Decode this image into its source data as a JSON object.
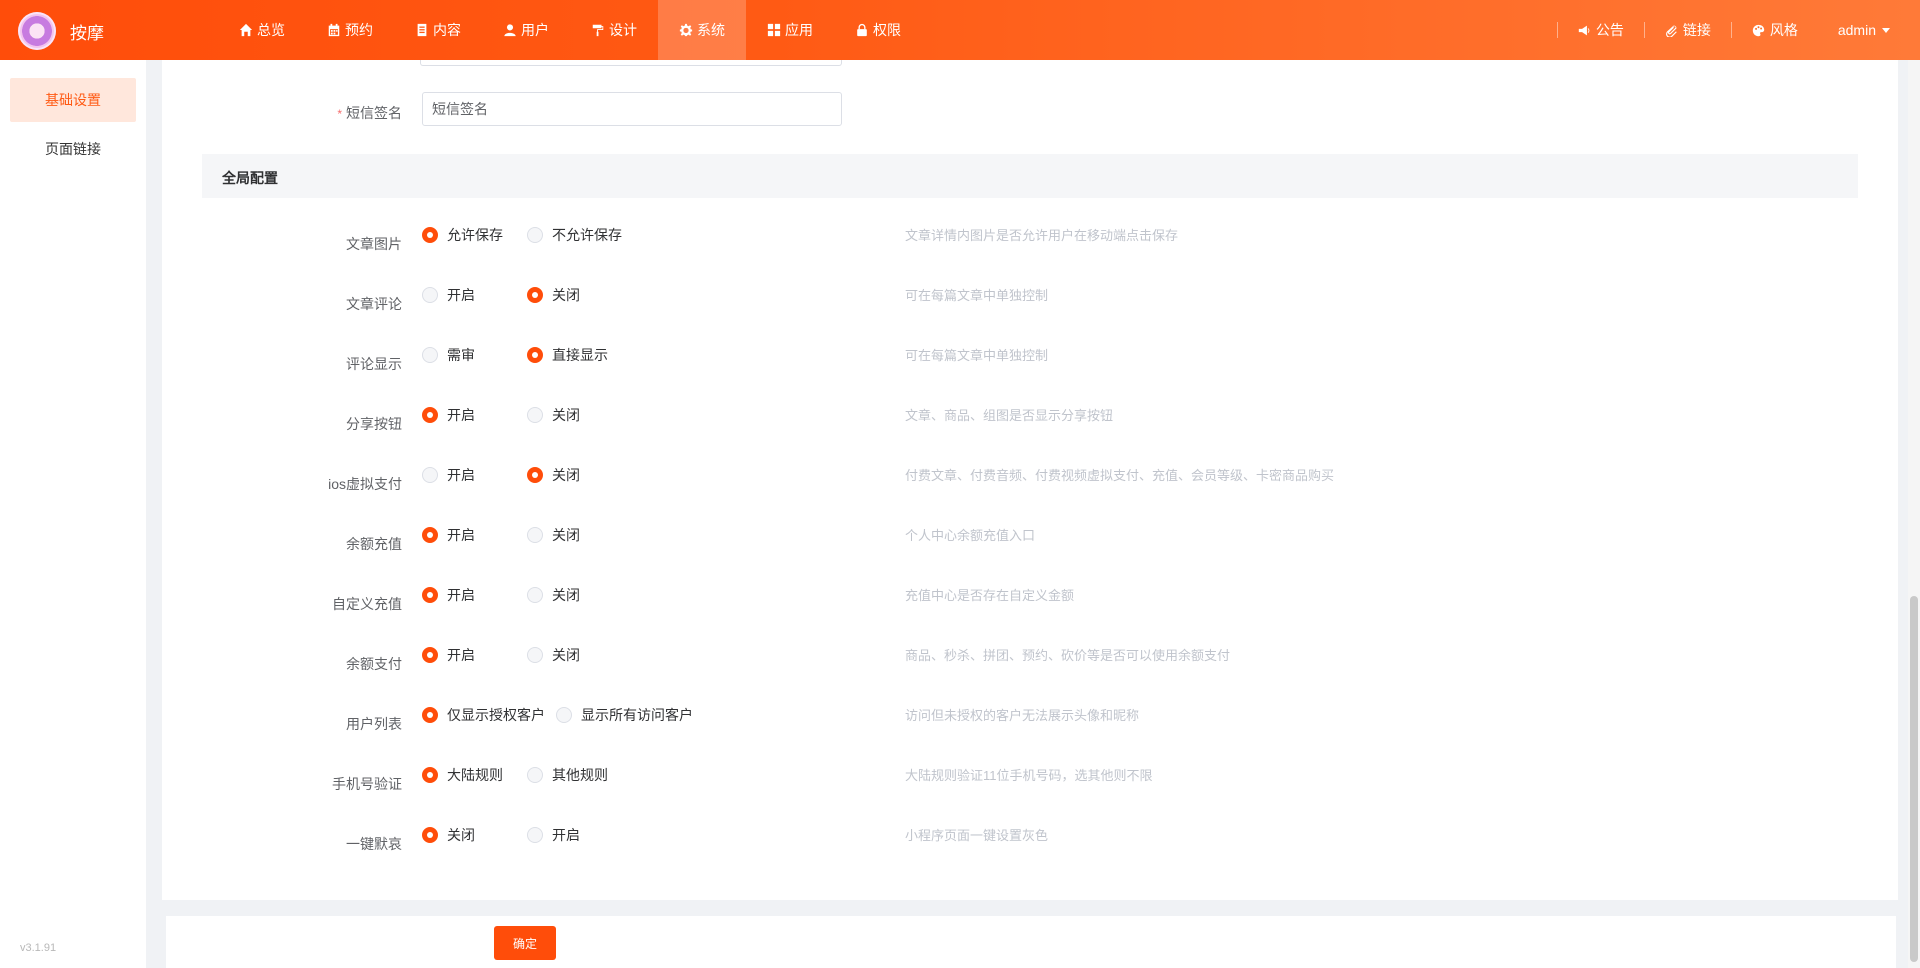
{
  "header": {
    "brand": "按摩",
    "nav": [
      {
        "label": "总览",
        "icon": "home-icon",
        "active": false
      },
      {
        "label": "预约",
        "icon": "calendar-icon",
        "active": false
      },
      {
        "label": "内容",
        "icon": "document-icon",
        "active": false
      },
      {
        "label": "用户",
        "icon": "user-icon",
        "active": false
      },
      {
        "label": "设计",
        "icon": "paint-roller-icon",
        "active": false
      },
      {
        "label": "系统",
        "icon": "gear-icon",
        "active": true
      },
      {
        "label": "应用",
        "icon": "grid-icon",
        "active": false
      },
      {
        "label": "权限",
        "icon": "lock-icon",
        "active": false
      }
    ],
    "tools": [
      {
        "label": "公告",
        "icon": "megaphone-icon"
      },
      {
        "label": "链接",
        "icon": "paperclip-icon"
      },
      {
        "label": "风格",
        "icon": "palette-icon"
      }
    ],
    "user": "admin"
  },
  "sidebar": {
    "items": [
      {
        "label": "基础设置",
        "active": true
      },
      {
        "label": "页面链接",
        "active": false
      }
    ],
    "version": "v3.1.91"
  },
  "form": {
    "sms_sign": {
      "label": "短信签名",
      "required": "*",
      "placeholder": "短信签名",
      "value": ""
    },
    "section_title": "全局配置",
    "rows": [
      {
        "label": "文章图片",
        "options": [
          "允许保存",
          "不允许保存"
        ],
        "selected": 0,
        "hint": "文章详情内图片是否允许用户在移动端点击保存"
      },
      {
        "label": "文章评论",
        "options": [
          "开启",
          "关闭"
        ],
        "selected": 1,
        "hint": "可在每篇文章中单独控制"
      },
      {
        "label": "评论显示",
        "options": [
          "需审",
          "直接显示"
        ],
        "selected": 1,
        "hint": "可在每篇文章中单独控制"
      },
      {
        "label": "分享按钮",
        "options": [
          "开启",
          "关闭"
        ],
        "selected": 0,
        "hint": "文章、商品、组图是否显示分享按钮"
      },
      {
        "label": "ios虚拟支付",
        "options": [
          "开启",
          "关闭"
        ],
        "selected": 1,
        "hint": "付费文章、付费音频、付费视频虚拟支付、充值、会员等级、卡密商品购买"
      },
      {
        "label": "余额充值",
        "options": [
          "开启",
          "关闭"
        ],
        "selected": 0,
        "hint": "个人中心余额充值入口"
      },
      {
        "label": "自定义充值",
        "options": [
          "开启",
          "关闭"
        ],
        "selected": 0,
        "hint": "充值中心是否存在自定义金额"
      },
      {
        "label": "余额支付",
        "options": [
          "开启",
          "关闭"
        ],
        "selected": 0,
        "hint": "商品、秒杀、拼团、预约、砍价等是否可以使用余额支付"
      },
      {
        "label": "用户列表",
        "options": [
          "仅显示授权客户",
          "显示所有访问客户"
        ],
        "selected": 0,
        "hint": "访问但未授权的客户无法展示头像和昵称"
      },
      {
        "label": "手机号验证",
        "options": [
          "大陆规则",
          "其他规则"
        ],
        "selected": 0,
        "hint": "大陆规则验证11位手机号码，选其他则不限"
      },
      {
        "label": "一键默哀",
        "options": [
          "关闭",
          "开启"
        ],
        "selected": 0,
        "hint": "小程序页面一键设置灰色"
      }
    ],
    "submit_label": "确定"
  },
  "colors": {
    "accent": "#ff4d0a",
    "hint": "#c0c4cc",
    "section_bg": "#f5f6f8"
  }
}
